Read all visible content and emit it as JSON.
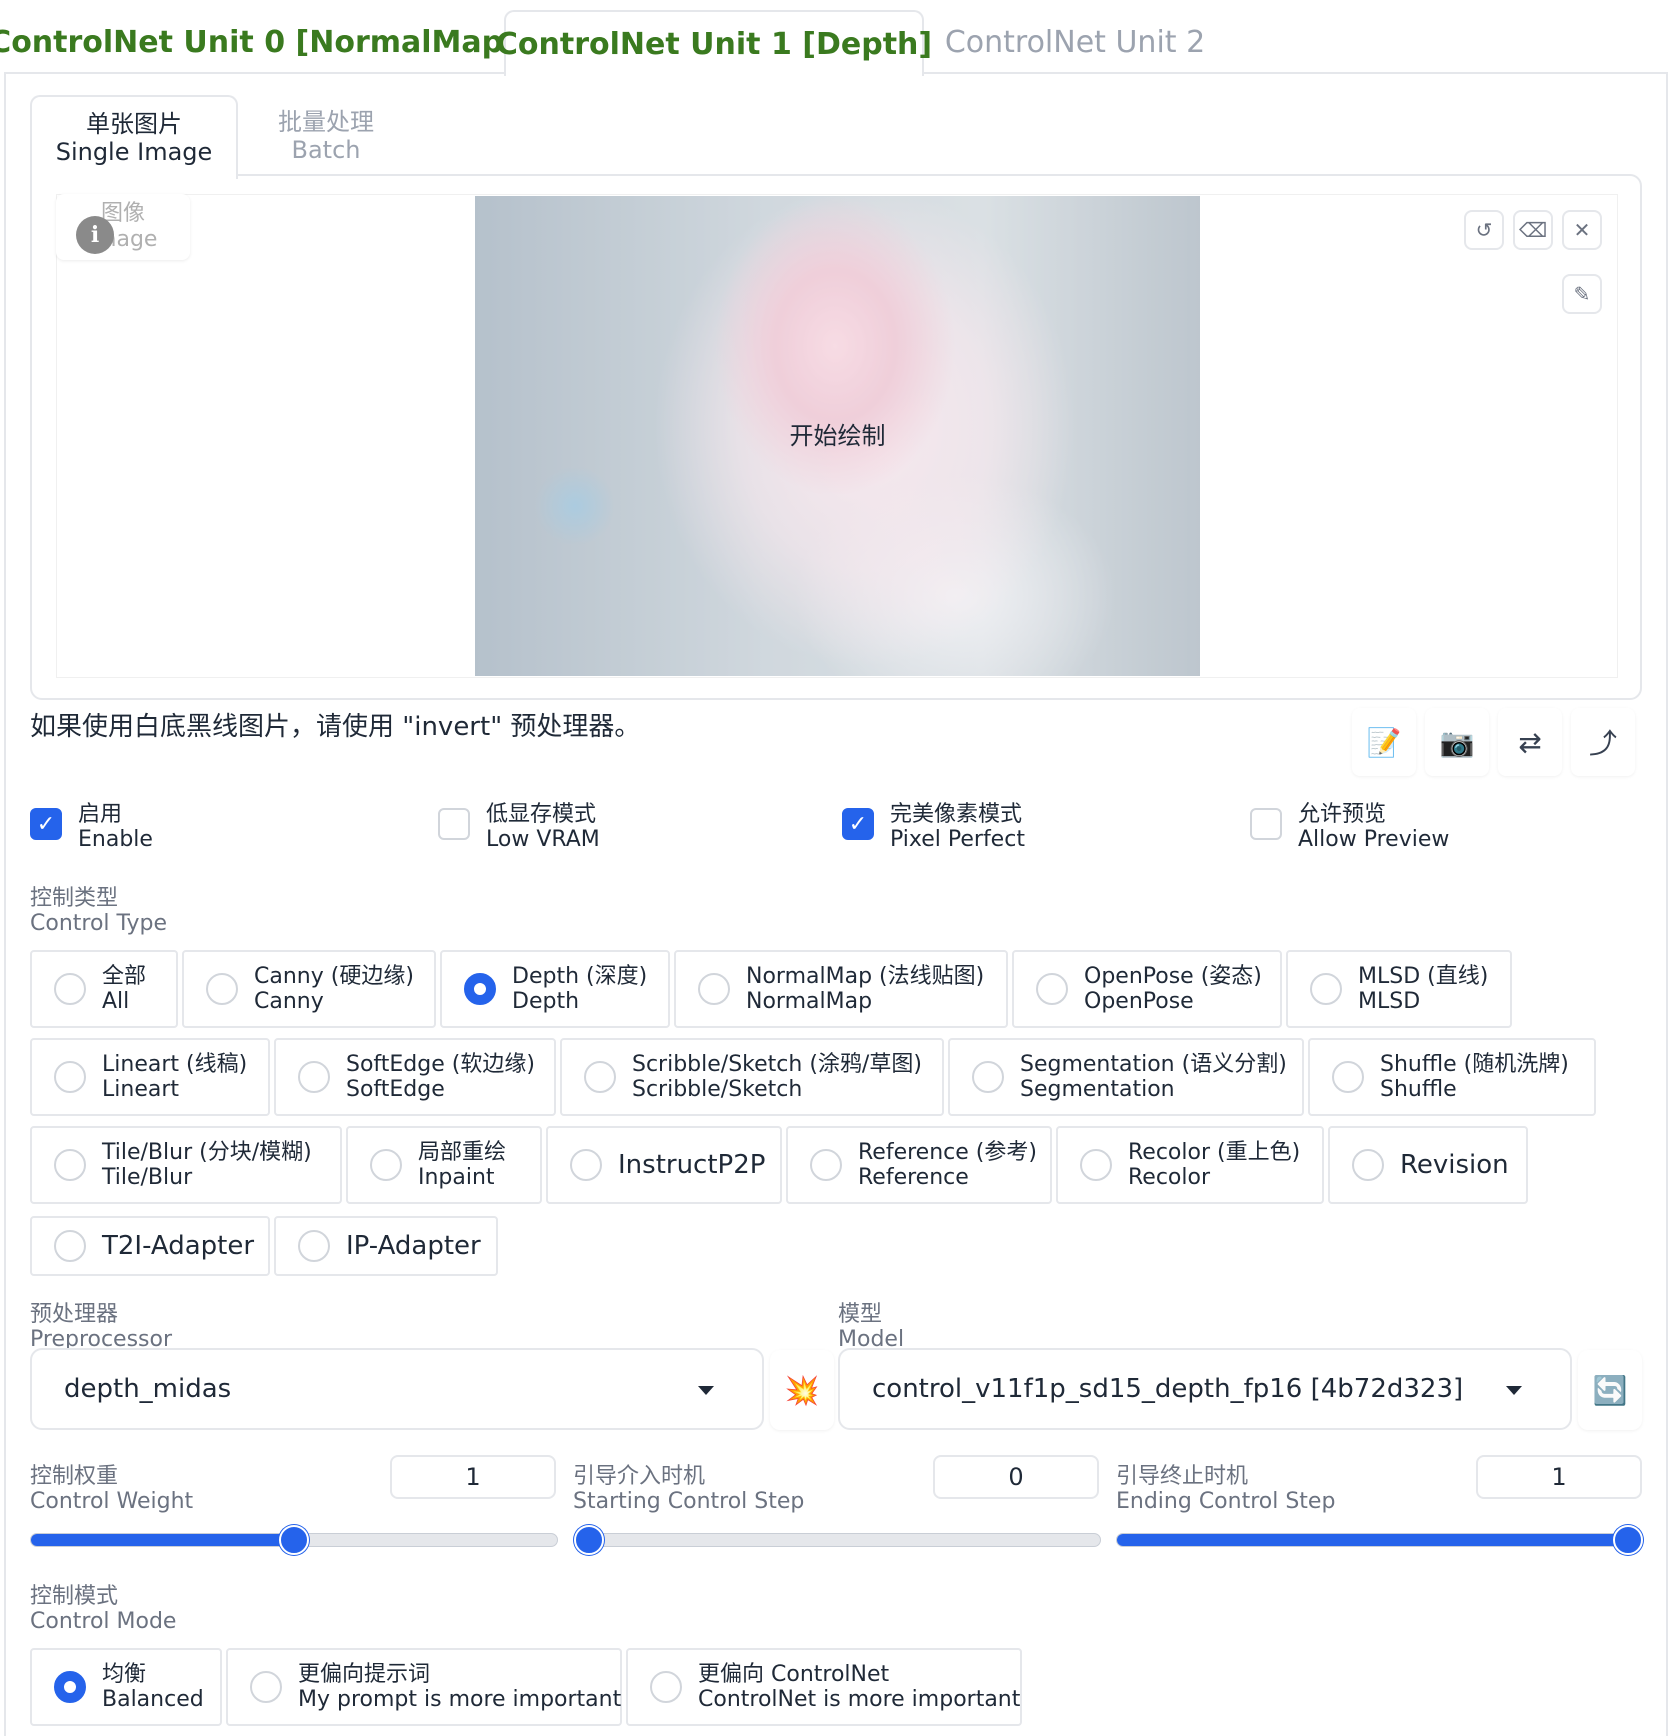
{
  "unit_tabs": [
    {
      "label": "ControlNet Unit 0 [NormalMap]",
      "state": "inactive-colored"
    },
    {
      "label": "ControlNet Unit 1 [Depth]",
      "state": "active"
    },
    {
      "label": "ControlNet Unit 2",
      "state": "inactive"
    }
  ],
  "sub_tabs": [
    {
      "zh": "单张图片",
      "en": "Single Image",
      "active": true
    },
    {
      "zh": "批量处理",
      "en": "Batch",
      "active": false
    }
  ],
  "image_panel": {
    "label_zh": "图像",
    "label_en": "Image",
    "info_icon": "i",
    "canvas_text": "开始绘制",
    "tools": [
      "undo-icon",
      "eraser-icon",
      "close-icon",
      "brush-icon"
    ]
  },
  "hint": "如果使用白底黑线图片，请使用 \"invert\" 预处理器。",
  "action_icons": [
    "notepad-icon",
    "camera-icon",
    "swap-icon",
    "upload-icon"
  ],
  "checkboxes": [
    {
      "zh": "启用",
      "en": "Enable",
      "checked": true
    },
    {
      "zh": "低显存模式",
      "en": "Low VRAM",
      "checked": false
    },
    {
      "zh": "完美像素模式",
      "en": "Pixel Perfect",
      "checked": true
    },
    {
      "zh": "允许预览",
      "en": "Allow Preview",
      "checked": false
    }
  ],
  "control_type": {
    "label_zh": "控制类型",
    "label_en": "Control Type",
    "options": [
      {
        "zh": "全部",
        "en": "All"
      },
      {
        "zh": "Canny (硬边缘)",
        "en": "Canny"
      },
      {
        "zh": "Depth (深度)",
        "en": "Depth",
        "selected": true
      },
      {
        "zh": "NormalMap (法线贴图)",
        "en": "NormalMap"
      },
      {
        "zh": "OpenPose (姿态)",
        "en": "OpenPose"
      },
      {
        "zh": "MLSD (直线)",
        "en": "MLSD"
      },
      {
        "zh": "Lineart (线稿)",
        "en": "Lineart"
      },
      {
        "zh": "SoftEdge (软边缘)",
        "en": "SoftEdge"
      },
      {
        "zh": "Scribble/Sketch (涂鸦/草图)",
        "en": "Scribble/Sketch"
      },
      {
        "zh": "Segmentation (语义分割)",
        "en": "Segmentation"
      },
      {
        "zh": "Shuffle (随机洗牌)",
        "en": "Shuffle"
      },
      {
        "zh": "Tile/Blur (分块/模糊)",
        "en": "Tile/Blur"
      },
      {
        "zh": "局部重绘",
        "en": "Inpaint"
      },
      {
        "zh": "InstructP2P",
        "en": ""
      },
      {
        "zh": "Reference (参考)",
        "en": "Reference"
      },
      {
        "zh": "Recolor (重上色)",
        "en": "Recolor"
      },
      {
        "zh": "Revision",
        "en": ""
      },
      {
        "zh": "T2I-Adapter",
        "en": ""
      },
      {
        "zh": "IP-Adapter",
        "en": ""
      }
    ]
  },
  "preprocessor": {
    "label_zh": "预处理器",
    "label_en": "Preprocessor",
    "value": "depth_midas",
    "run_icon": "explosion-icon"
  },
  "model": {
    "label_zh": "模型",
    "label_en": "Model",
    "value": "control_v11f1p_sd15_depth_fp16 [4b72d323]",
    "refresh_icon": "refresh-icon"
  },
  "sliders": [
    {
      "zh": "控制权重",
      "en": "Control Weight",
      "value": "1",
      "fraction": 0.5
    },
    {
      "zh": "引导介入时机",
      "en": "Starting Control Step",
      "value": "0",
      "fraction": 0.0
    },
    {
      "zh": "引导终止时机",
      "en": "Ending Control Step",
      "value": "1",
      "fraction": 1.0
    }
  ],
  "control_mode": {
    "label_zh": "控制模式",
    "label_en": "Control Mode",
    "options": [
      {
        "zh": "均衡",
        "en": "Balanced",
        "selected": true
      },
      {
        "zh": "更偏向提示词",
        "en": "My prompt is more important"
      },
      {
        "zh": "更偏向 ControlNet",
        "en": "ControlNet is more important"
      }
    ]
  },
  "colors": {
    "accent": "#2563eb",
    "tab_green": "#3a7a1f"
  }
}
